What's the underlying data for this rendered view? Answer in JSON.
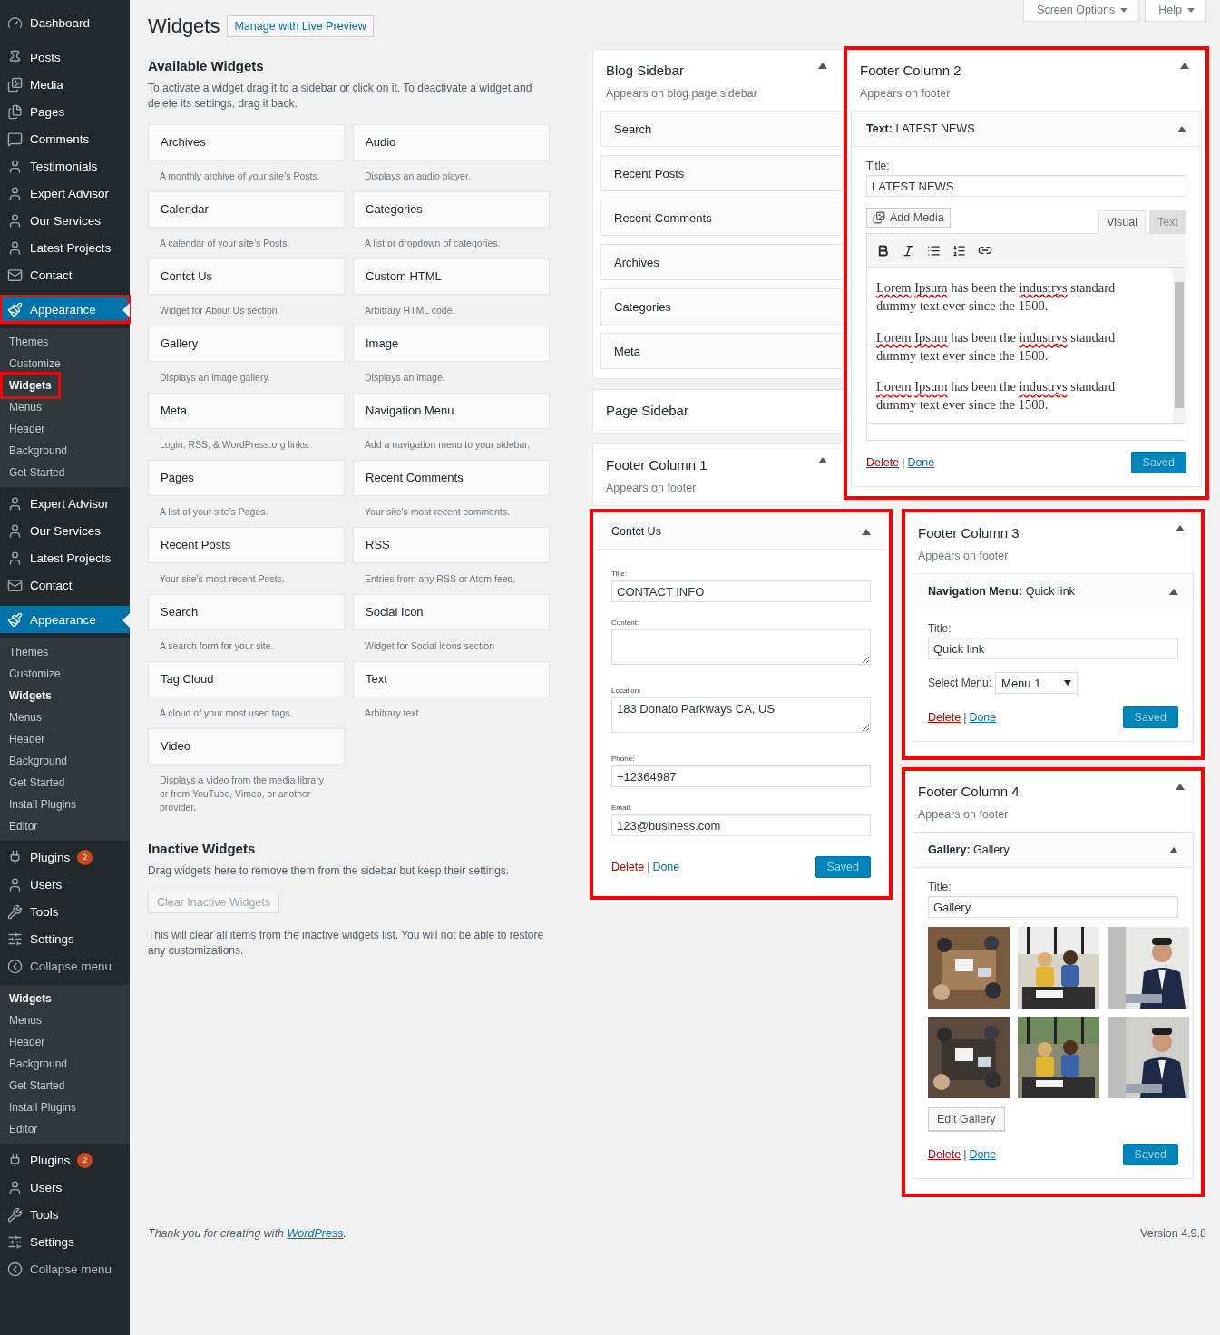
{
  "top_tabs": [
    {
      "label": "Screen Options"
    },
    {
      "label": "Help"
    }
  ],
  "sidebar": {
    "sections": [
      {
        "kind": "menu",
        "items": [
          {
            "label": "Dashboard",
            "kind": "dashboard",
            "selected": false,
            "highlighted": false
          }
        ]
      },
      {
        "kind": "menu",
        "items": [
          {
            "label": "Posts",
            "kind": "pin",
            "selected": false,
            "highlighted": false
          },
          {
            "label": "Media",
            "kind": "media",
            "selected": false,
            "highlighted": false
          },
          {
            "label": "Pages",
            "kind": "pages",
            "selected": false,
            "highlighted": false
          },
          {
            "label": "Comments",
            "kind": "comment",
            "selected": false,
            "highlighted": false
          },
          {
            "label": "Testimonials",
            "kind": "person",
            "selected": false,
            "highlighted": false
          },
          {
            "label": "Expert Advisor",
            "kind": "person",
            "selected": false,
            "highlighted": false
          },
          {
            "label": "Our Services",
            "kind": "person",
            "selected": false,
            "highlighted": false
          },
          {
            "label": "Latest Projects",
            "kind": "person",
            "selected": false,
            "highlighted": false
          },
          {
            "label": "Contact",
            "kind": "mail",
            "selected": false,
            "highlighted": false
          }
        ]
      },
      {
        "kind": "menu",
        "items": [
          {
            "label": "Appearance",
            "kind": "brush",
            "selected": true,
            "highlighted": true
          }
        ]
      },
      {
        "kind": "submenu",
        "items": [
          {
            "label": "Themes",
            "selected": false,
            "highlighted": false
          },
          {
            "label": "Customize",
            "selected": false,
            "highlighted": false
          },
          {
            "label": "Widgets",
            "selected": true,
            "highlighted": true
          },
          {
            "label": "Menus",
            "selected": false,
            "highlighted": false
          },
          {
            "label": "Header",
            "selected": false,
            "highlighted": false
          },
          {
            "label": "Background",
            "selected": false,
            "highlighted": false
          },
          {
            "label": "Get Started",
            "selected": false,
            "highlighted": false
          }
        ]
      },
      {
        "kind": "menu",
        "items": [
          {
            "label": "Expert Advisor",
            "kind": "person",
            "selected": false,
            "highlighted": false
          },
          {
            "label": "Our Services",
            "kind": "person",
            "selected": false,
            "highlighted": false
          },
          {
            "label": "Latest Projects",
            "kind": "person",
            "selected": false,
            "highlighted": false
          },
          {
            "label": "Contact",
            "kind": "mail",
            "selected": false,
            "highlighted": false
          }
        ]
      },
      {
        "kind": "menu",
        "items": [
          {
            "label": "Appearance",
            "kind": "brush",
            "selected": true,
            "highlighted": false
          }
        ]
      },
      {
        "kind": "submenu",
        "items": [
          {
            "label": "Themes",
            "selected": false,
            "highlighted": false
          },
          {
            "label": "Customize",
            "selected": false,
            "highlighted": false
          },
          {
            "label": "Widgets",
            "selected": true,
            "highlighted": false
          },
          {
            "label": "Menus",
            "selected": false,
            "highlighted": false
          },
          {
            "label": "Header",
            "selected": false,
            "highlighted": false
          },
          {
            "label": "Background",
            "selected": false,
            "highlighted": false
          },
          {
            "label": "Get Started",
            "selected": false,
            "highlighted": false
          },
          {
            "label": "Install Plugins",
            "selected": false,
            "highlighted": false
          },
          {
            "label": "Editor",
            "selected": false,
            "highlighted": false
          }
        ]
      },
      {
        "kind": "menu",
        "items": [
          {
            "label": "Plugins",
            "kind": "plug",
            "badge": "2",
            "selected": false,
            "highlighted": false
          },
          {
            "label": "Users",
            "kind": "person",
            "selected": false,
            "highlighted": false
          },
          {
            "label": "Tools",
            "kind": "wrench",
            "selected": false,
            "highlighted": false
          },
          {
            "label": "Settings",
            "kind": "sliders",
            "selected": false,
            "highlighted": false
          },
          {
            "label": "Collapse menu",
            "kind": "collapse",
            "selected": false,
            "highlighted": false
          }
        ]
      },
      {
        "kind": "submenu",
        "items": [
          {
            "label": "Widgets",
            "selected": true,
            "highlighted": false
          },
          {
            "label": "Menus",
            "selected": false,
            "highlighted": false
          },
          {
            "label": "Header",
            "selected": false,
            "highlighted": false
          },
          {
            "label": "Background",
            "selected": false,
            "highlighted": false
          },
          {
            "label": "Get Started",
            "selected": false,
            "highlighted": false
          },
          {
            "label": "Install Plugins",
            "selected": false,
            "highlighted": false
          },
          {
            "label": "Editor",
            "selected": false,
            "highlighted": false
          }
        ]
      },
      {
        "kind": "menu",
        "items": [
          {
            "label": "Plugins",
            "kind": "plug",
            "badge": "2",
            "selected": false,
            "highlighted": false
          },
          {
            "label": "Users",
            "kind": "person",
            "selected": false,
            "highlighted": false
          },
          {
            "label": "Tools",
            "kind": "wrench",
            "selected": false,
            "highlighted": false
          },
          {
            "label": "Settings",
            "kind": "sliders",
            "selected": false,
            "highlighted": false
          },
          {
            "label": "Collapse menu",
            "kind": "collapse",
            "selected": false,
            "highlighted": false
          }
        ]
      }
    ]
  },
  "page": {
    "title": "Widgets",
    "action": "Manage with Live Preview"
  },
  "available": {
    "heading": "Available Widgets",
    "intro": "To activate a widget drag it to a sidebar or click on it. To deactivate a widget and delete its settings, drag it back.",
    "widgets": [
      {
        "name": "Archives",
        "description": "A monthly archive of your site’s Posts."
      },
      {
        "name": "Audio",
        "description": "Displays an audio player."
      },
      {
        "name": "Calendar",
        "description": "A calendar of your site’s Posts."
      },
      {
        "name": "Categories",
        "description": "A list or dropdown of categories."
      },
      {
        "name": "Contct Us",
        "description": "Widget for About Us section"
      },
      {
        "name": "Custom HTML",
        "description": "Arbitrary HTML code."
      },
      {
        "name": "Gallery",
        "description": "Displays an image gallery."
      },
      {
        "name": "Image",
        "description": "Displays an image."
      },
      {
        "name": "Meta",
        "description": "Login, RSS, & WordPress.org links."
      },
      {
        "name": "Navigation Menu",
        "description": "Add a navigation menu to your sidebar."
      },
      {
        "name": "Pages",
        "description": "A list of your site’s Pages."
      },
      {
        "name": "Recent Comments",
        "description": "Your site’s most recent comments."
      },
      {
        "name": "Recent Posts",
        "description": "Your site’s most recent Posts."
      },
      {
        "name": "RSS",
        "description": "Entries from any RSS or Atom feed."
      },
      {
        "name": "Search",
        "description": "A search form for your site."
      },
      {
        "name": "Social Icon",
        "description": "Widget for Social icons section"
      },
      {
        "name": "Tag Cloud",
        "description": "A cloud of your most used tags."
      },
      {
        "name": "Text",
        "description": "Arbitrary text."
      },
      {
        "name": "Video",
        "description": "Displays a video from the media library or from YouTube, Vimeo, or another provider."
      }
    ]
  },
  "inactive": {
    "heading": "Inactive Widgets",
    "intro": "Drag widgets here to remove them from the sidebar but keep their settings.",
    "button": "Clear Inactive Widgets",
    "disabled": true,
    "note": "This will clear all items from the inactive widgets list. You will not be able to restore any customizations."
  },
  "blog_sidebar": {
    "title": "Blog Sidebar",
    "subtitle": "Appears on blog page sidebar",
    "widgets": [
      "Search",
      "Recent Posts",
      "Recent Comments",
      "Archives",
      "Categories",
      "Meta"
    ]
  },
  "page_sidebar": {
    "title": "Page Sidebar"
  },
  "footer_1": {
    "title": "Footer Column 1",
    "subtitle": "Appears on footer",
    "widget": {
      "name": "Contct Us",
      "highlighted": true,
      "separator": "|",
      "fields": [
        {
          "label": "Title:",
          "kind": "input",
          "value": "CONTACT INFO"
        },
        {
          "label": "Content:",
          "kind": "textarea"
        },
        {
          "label": "Location:",
          "kind": "textarea",
          "value": "183 Donato Parkways CA, US"
        },
        {
          "label": "Phone:",
          "kind": "input",
          "value": "+12364987"
        },
        {
          "label": "Email:",
          "kind": "input",
          "value": "123@business.com"
        }
      ],
      "delete": "Delete",
      "done": "Done",
      "save": "Saved"
    }
  },
  "footer_2": {
    "title": "Footer Column 2",
    "subtitle": "Appears on footer",
    "highlighted": true,
    "widget": {
      "type": "Text:",
      "name": "LATEST NEWS",
      "title_label": "Title:",
      "title_value": "LATEST NEWS",
      "add_media": "Add Media",
      "tabs": [
        {
          "label": "Visual",
          "selected": true
        },
        {
          "label": "Text",
          "selected": false
        }
      ],
      "paragraphs": [
        [
          {
            "text": "Lorem",
            "misspelled": true
          },
          {
            "text": "Ipsum",
            "misspelled": true
          },
          {
            "text": "has been the",
            "misspelled": false
          },
          {
            "text": "industrys",
            "misspelled": true
          },
          {
            "text": "standard dummy text ever since the 1500.",
            "misspelled": false
          }
        ],
        [
          {
            "text": "Lorem",
            "misspelled": true
          },
          {
            "text": "Ipsum",
            "misspelled": true
          },
          {
            "text": "has been the",
            "misspelled": false
          },
          {
            "text": "industrys",
            "misspelled": true
          },
          {
            "text": "standard dummy text ever since the 1500.",
            "misspelled": false
          }
        ],
        [
          {
            "text": "Lorem",
            "misspelled": true
          },
          {
            "text": "Ipsum",
            "misspelled": true
          },
          {
            "text": "has been the",
            "misspelled": false
          },
          {
            "text": "industrys",
            "misspelled": true
          },
          {
            "text": "standard dummy text ever since the 1500.",
            "misspelled": false
          }
        ]
      ],
      "delete": "Delete",
      "separator": "|",
      "done": "Done",
      "save": "Saved"
    }
  },
  "footer_3": {
    "title": "Footer Column 3",
    "subtitle": "Appears on footer",
    "highlighted": true,
    "widget": {
      "type": "Navigation Menu:",
      "name": "Quick link",
      "title_label": "Title:",
      "title_value": "Quick link",
      "select_label": "Select Menu:",
      "select_value": "Menu 1",
      "delete": "Delete",
      "separator": "|",
      "done": "Done",
      "save": "Saved"
    }
  },
  "footer_4": {
    "title": "Footer Column 4",
    "subtitle": "Appears on footer",
    "highlighted": true,
    "widget": {
      "type": "Gallery:",
      "name": "Gallery",
      "title_label": "Title:",
      "title_value": "Gallery",
      "edit": "Edit Gallery",
      "delete": "Delete",
      "separator": "|",
      "done": "Done",
      "save": "Saved"
    }
  },
  "footer": {
    "thanks": "Thank you for creating with",
    "link": "WordPress",
    "end": ".",
    "version": "Version 4.9.8"
  }
}
